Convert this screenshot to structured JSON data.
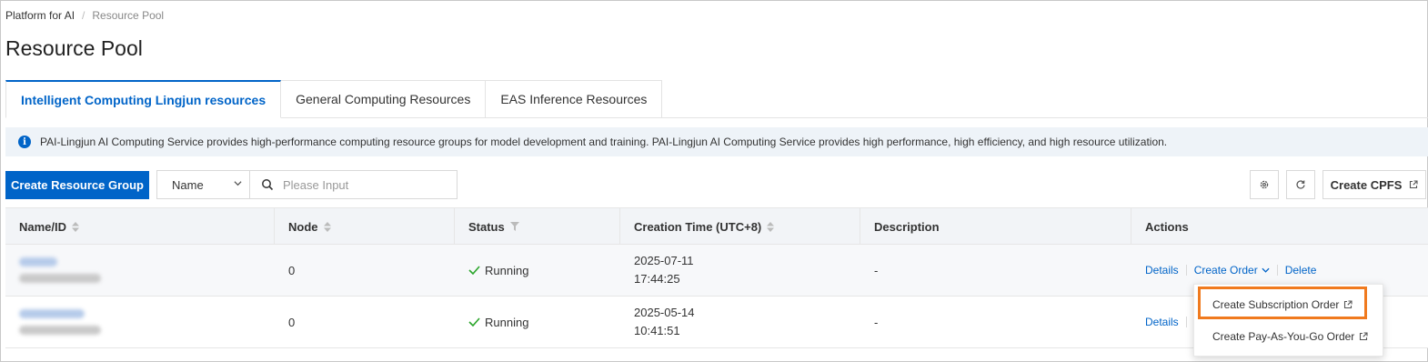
{
  "breadcrumb": {
    "root": "Platform for AI",
    "separator": "/",
    "current": "Resource Pool"
  },
  "page_title": "Resource Pool",
  "tabs": [
    {
      "label": "Intelligent Computing Lingjun resources",
      "active": true
    },
    {
      "label": "General Computing Resources",
      "active": false
    },
    {
      "label": "EAS Inference Resources",
      "active": false
    }
  ],
  "notice": {
    "icon": "info-icon",
    "text": "PAI-Lingjun AI Computing Service provides high-performance computing resource groups for model development and training. PAI-Lingjun AI Computing Service provides high performance, high efficiency, and high resource utilization."
  },
  "toolbar": {
    "create_button": "Create Resource Group",
    "filter_select": "Name",
    "search_placeholder": "Please Input",
    "settings_icon": "gear-icon",
    "refresh_icon": "refresh-icon",
    "cpfs_button": "Create CPFS"
  },
  "table": {
    "headers": [
      "Name/ID",
      "Node",
      "Status",
      "Creation Time (UTC+8)",
      "Description",
      "Actions"
    ],
    "rows": [
      {
        "node": "0",
        "status": "Running",
        "date": "2025-07-11",
        "time": "17:44:25",
        "description": "-",
        "actions": [
          "Details",
          "Create Order",
          "Delete"
        ]
      },
      {
        "node": "0",
        "status": "Running",
        "date": "2025-05-14",
        "time": "10:41:51",
        "description": "-",
        "actions": [
          "Details"
        ]
      }
    ]
  },
  "dropdown": {
    "items": [
      "Create Subscription Order",
      "Create Pay-As-You-Go Order"
    ],
    "highlighted": "Create Subscription Order"
  },
  "colors": {
    "primary": "#0064c8",
    "highlight": "#f07a1e",
    "success": "#2aa52a",
    "notice_bg": "#eef3f8"
  }
}
